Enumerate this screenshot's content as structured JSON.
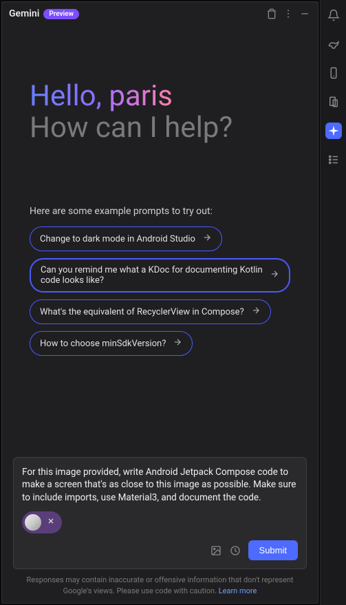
{
  "header": {
    "title": "Gemini",
    "badge": "Preview"
  },
  "greeting": {
    "word1": "Hello,",
    "word2": "paris",
    "line2": "How can I help?"
  },
  "exampleLabel": "Here are some example prompts to try out:",
  "chips": [
    "Change to dark mode in Android Studio",
    "Can you remind me what a KDoc for documenting Kotlin code looks like?",
    "What's the equivalent of RecyclerView in Compose?",
    "How to choose minSdkVersion?"
  ],
  "input": {
    "text": "For this image provided, write Android Jetpack Compose code to make a screen that's as close to this image as possible. Make sure to include imports, use Material3, and document the code.",
    "submit": "Submit"
  },
  "disclaimer": {
    "text": "Responses may contain inaccurate or offensive information that don't represent Google's views. Please use code with caution. ",
    "link": "Learn more"
  }
}
